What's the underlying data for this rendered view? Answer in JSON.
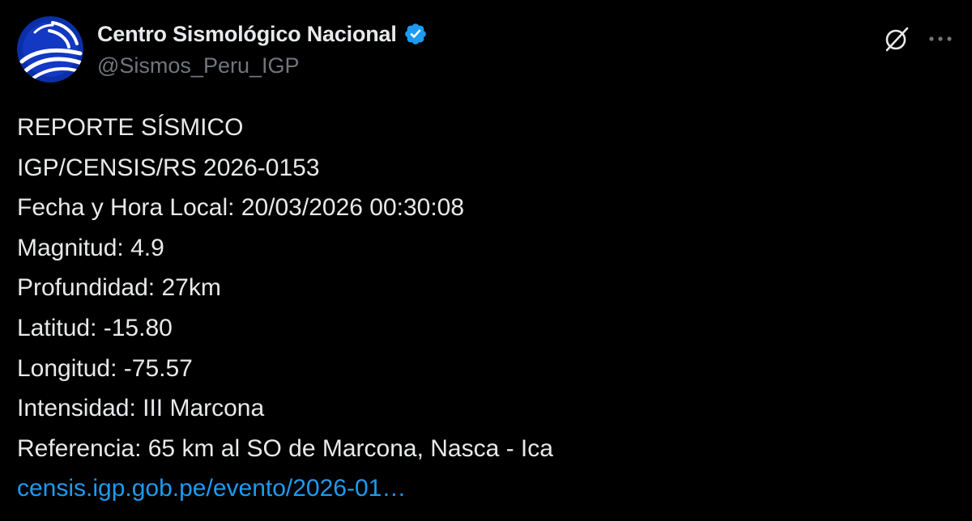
{
  "colors": {
    "background": "#000000",
    "text": "#e7e9ea",
    "secondary_text": "#71767b",
    "link": "#1d9bf0",
    "verified_badge": "#1d9bf0"
  },
  "author": {
    "display_name": "Centro Sismológico Nacional",
    "handle": "@Sismos_Peru_IGP",
    "verified": true,
    "avatar_icon": "igp-logo-avatar",
    "verified_icon": "verified-badge-icon"
  },
  "actions": {
    "grok_icon": "grok-icon",
    "more_icon": "more-options-icon"
  },
  "post": {
    "lines": [
      "REPORTE SÍSMICO",
      "IGP/CENSIS/RS 2026-0153",
      "Fecha y Hora Local: 20/03/2026 00:30:08",
      "Magnitud: 4.9",
      "Profundidad: 27km",
      "Latitud: -15.80",
      "Longitud: -75.57",
      "Intensidad: III Marcona",
      "Referencia: 65 km al SO de Marcona, Nasca - Ica"
    ],
    "link_text": "censis.igp.gob.pe/evento/2026-01…"
  }
}
